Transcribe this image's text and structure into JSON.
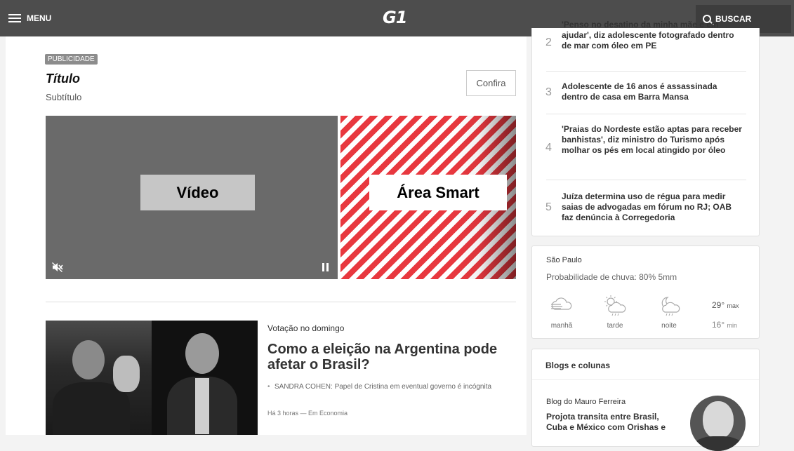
{
  "header": {
    "menu_label": "MENU",
    "logo_text": "G1",
    "search_label": "BUSCAR",
    "bg_color": "#4d4d4d"
  },
  "ad": {
    "badge": "PUBLICIDADE",
    "title": "Título",
    "subtitle": "Subtítulo",
    "cta": "Confira",
    "video_label": "Vídeo",
    "smart_label": "Área Smart"
  },
  "news": {
    "kicker": "Votação no domingo",
    "headline": "Como a eleição na Argentina pode afetar o Brasil?",
    "related": "SANDRA COHEN: Papel de Cristina em eventual governo é incógnita",
    "meta": "Há 3 horas — Em Economia"
  },
  "ranking": {
    "items": [
      {
        "num": "2",
        "text": "'Penso no desatino da minha mãe e em ajudar', diz adolescente fotografado dentro de mar com óleo em PE"
      },
      {
        "num": "3",
        "text": "Adolescente de 16 anos é assassinada dentro de casa em Barra Mansa"
      },
      {
        "num": "4",
        "text": "'Praias do Nordeste estão aptas para receber banhistas', diz ministro do Turismo após molhar os pés em local atingido por óleo"
      },
      {
        "num": "5",
        "text": "Juíza determina uso de régua para medir saias de advogadas em fórum no RJ; OAB faz denúncia à Corregedoria"
      }
    ]
  },
  "weather": {
    "city": "São Paulo",
    "probability": "Probabilidade de chuva: 80% 5mm",
    "periods": [
      {
        "label": "manhã",
        "icon": "fog-icon"
      },
      {
        "label": "tarde",
        "icon": "sun-cloud-rain-icon"
      },
      {
        "label": "noite",
        "icon": "moon-cloud-rain-icon"
      }
    ],
    "max_value": "29°",
    "max_label": "max",
    "min_value": "16°",
    "min_label": "min"
  },
  "blogs": {
    "heading": "Blogs e colunas",
    "author": "Blog do Mauro Ferreira",
    "title": "Projota transita entre Brasil, Cuba e México com Orishas e"
  }
}
